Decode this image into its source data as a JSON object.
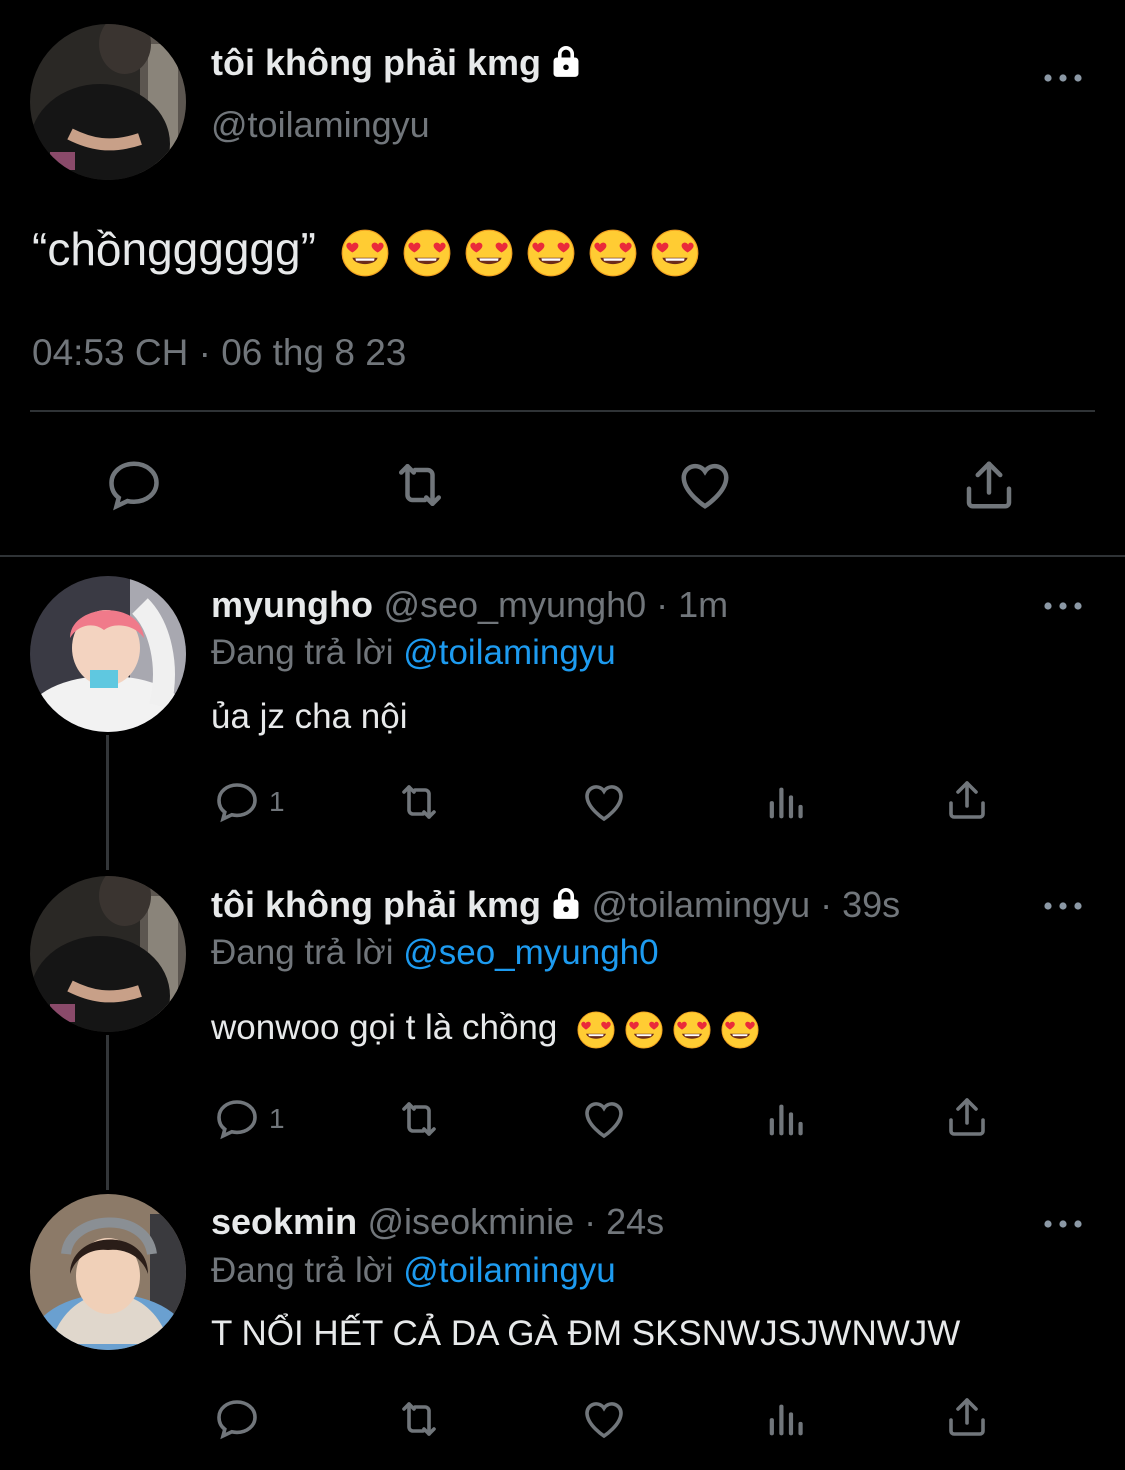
{
  "main_tweet": {
    "display_name": "tôi không phải kmg",
    "handle": "@toilamingyu",
    "text": "“chồngggggg”",
    "emoji": [
      "heart-eyes",
      "heart-eyes",
      "heart-eyes",
      "heart-eyes",
      "heart-eyes",
      "heart-eyes"
    ],
    "timestamp": "04:53 CH · 06 thg 8 23"
  },
  "replies": [
    {
      "display_name": "myungho",
      "handle_time": "@seo_myungh0 · 1m",
      "replying_prefix": "Đang trả lời",
      "replying_to": "@toilamingyu",
      "text": "ủa jz cha nội",
      "reply_count": "1"
    },
    {
      "display_name": "tôi không phải kmg",
      "handle_time": "@toilamingyu · 39s",
      "replying_prefix": "Đang trả lời",
      "replying_to": "@seo_myungh0",
      "text": "wonwoo gọi t là chồng",
      "emoji": [
        "heart-eyes",
        "heart-eyes",
        "heart-eyes",
        "heart-eyes"
      ],
      "reply_count": "1"
    },
    {
      "display_name": "seokmin",
      "handle_time": "@iseokminie · 24s",
      "replying_prefix": "Đang trả lời",
      "replying_to": "@toilamingyu",
      "text": "T NỔI HẾT CẢ DA GÀ ĐM SKSNWJSJWNWJW",
      "reply_count": ""
    }
  ],
  "colors": {
    "background": "#000000",
    "text": "#e7e9ea",
    "secondary": "#71767b",
    "link": "#1d9bf0"
  }
}
